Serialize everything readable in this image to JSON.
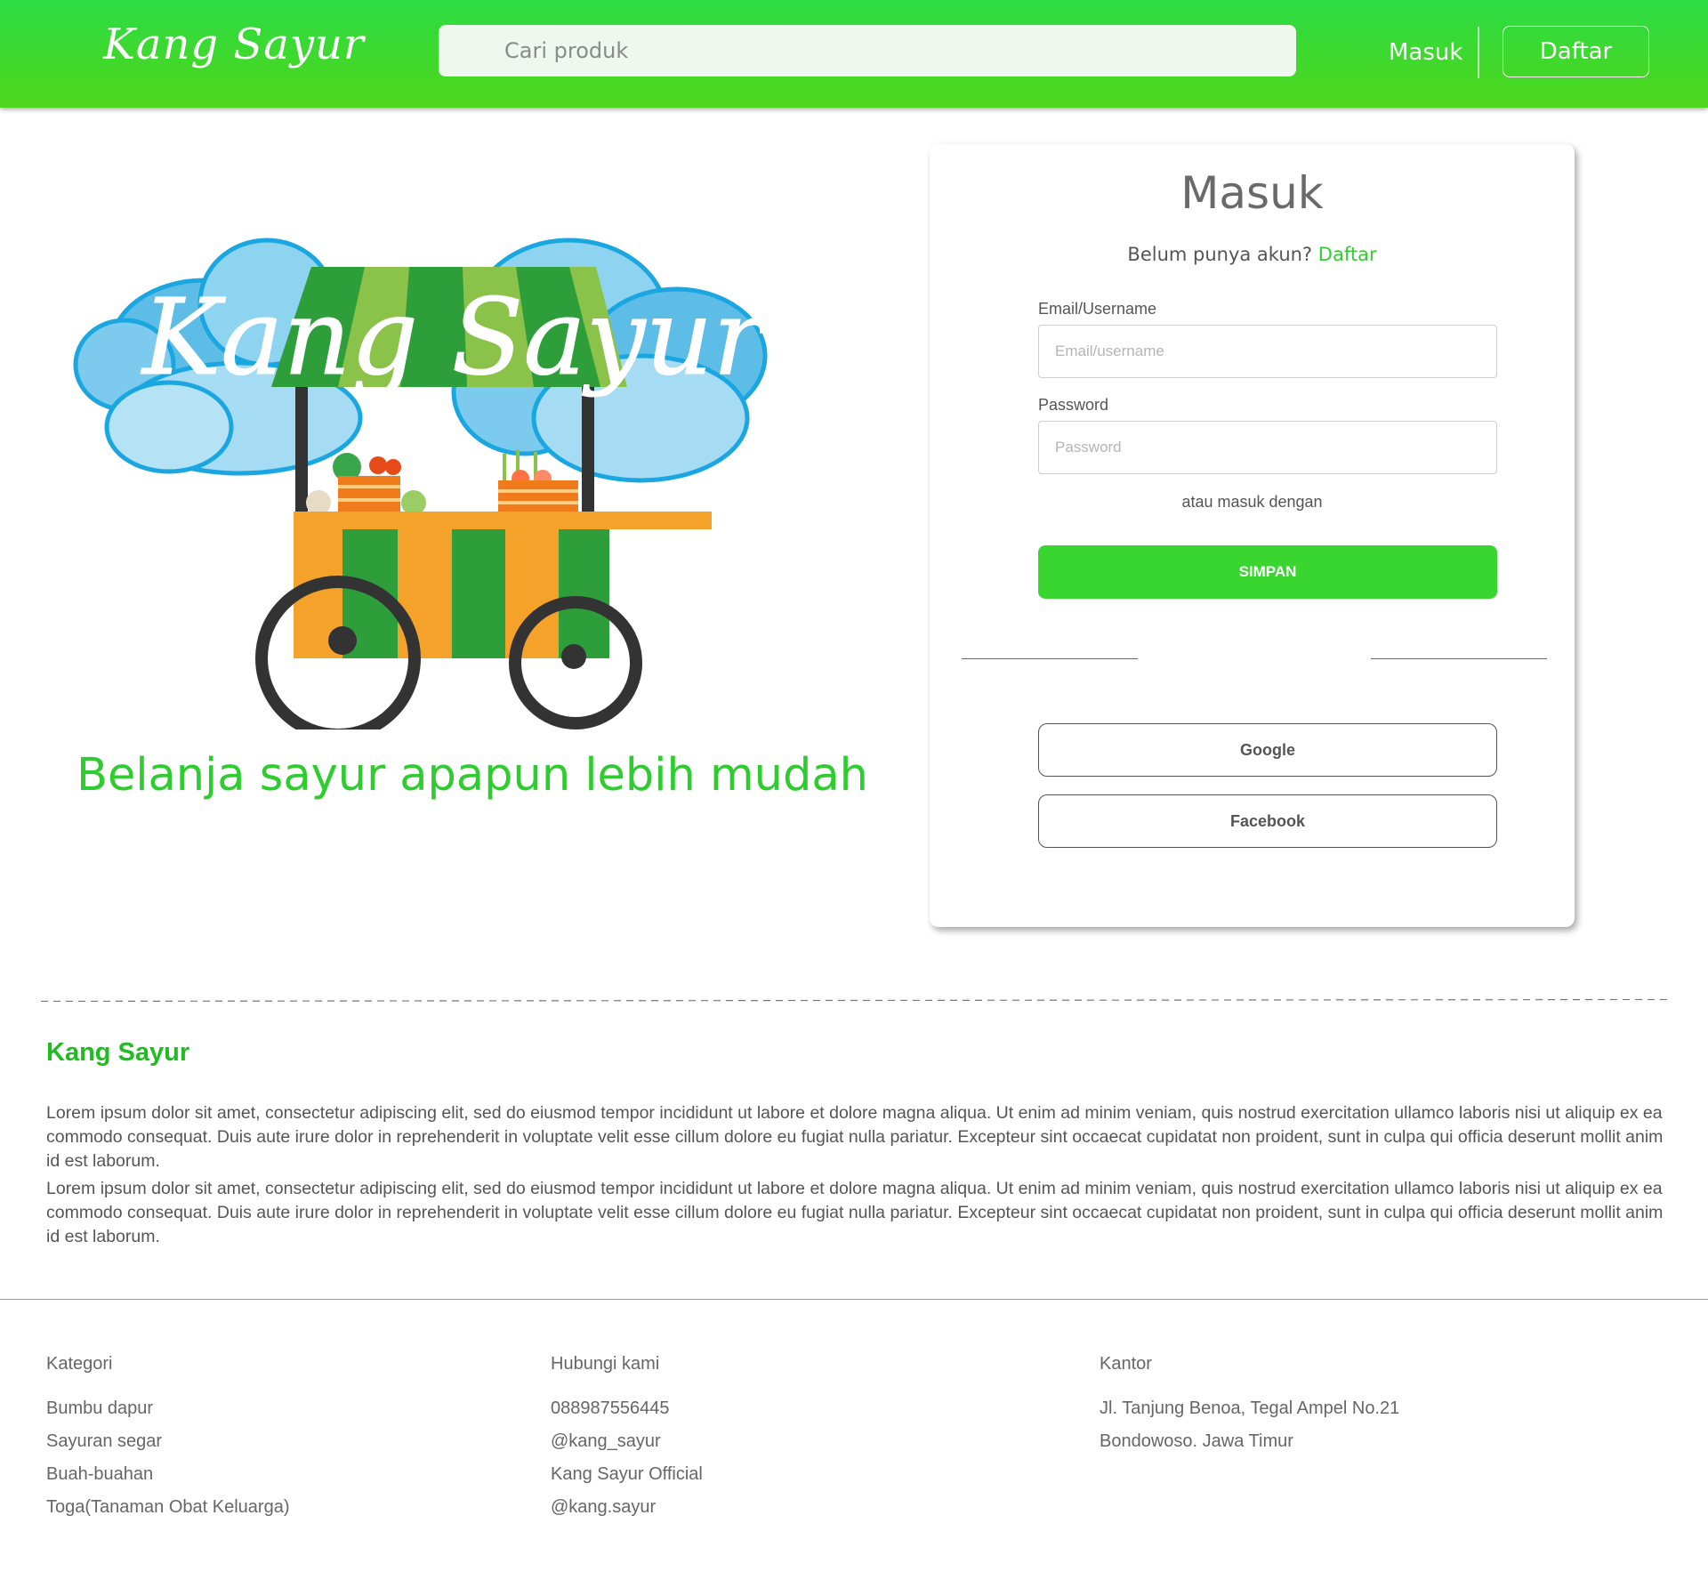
{
  "header": {
    "logo": "Kang Sayur",
    "search_placeholder": "Cari produk",
    "login_label": "Masuk",
    "register_label": "Daftar"
  },
  "hero": {
    "image_logo_text": "Kang Sayur",
    "tagline": "Belanja sayur apapun lebih mudah"
  },
  "login": {
    "title": "Masuk",
    "no_account_text": "Belum punya akun?",
    "register_link": "Daftar",
    "email_label": "Email/Username",
    "email_placeholder": "Email/username",
    "password_label": "Password",
    "password_placeholder": "Password",
    "alt_login_text": "atau masuk dengan",
    "submit_label": "SIMPAN",
    "google_label": "Google",
    "facebook_label": "Facebook"
  },
  "about": {
    "title": "Kang Sayur",
    "paragraphs": [
      "Lorem ipsum dolor sit amet, consectetur adipiscing elit, sed do eiusmod tempor incididunt ut labore et dolore magna aliqua. Ut enim ad minim veniam, quis nostrud exercitation ullamco laboris nisi ut aliquip ex ea commodo consequat. Duis aute irure dolor in reprehenderit in voluptate velit esse cillum dolore eu fugiat nulla pariatur. Excepteur sint occaecat cupidatat non proident, sunt in culpa qui officia deserunt mollit anim id est laborum.",
      "Lorem ipsum dolor sit amet, consectetur adipiscing elit, sed do eiusmod tempor incididunt ut labore et dolore magna aliqua. Ut enim ad minim veniam, quis nostrud exercitation ullamco laboris nisi ut aliquip ex ea commodo consequat. Duis aute irure dolor in reprehenderit in voluptate velit esse cillum dolore eu fugiat nulla pariatur. Excepteur sint occaecat cupidatat non proident, sunt in culpa qui officia deserunt mollit anim id est laborum."
    ]
  },
  "footer": {
    "kategori": {
      "title": "Kategori",
      "items": [
        "Bumbu dapur",
        "Sayuran segar",
        "Buah-buahan",
        "Toga(Tanaman Obat Keluarga)"
      ]
    },
    "hubungi": {
      "title": "Hubungi kami",
      "items": [
        "088987556445",
        "@kang_sayur",
        "Kang Sayur Official",
        "@kang.sayur"
      ]
    },
    "kantor": {
      "title": "Kantor",
      "items": [
        "Jl. Tanjung Benoa, Tegal Ampel No.21",
        "Bondowoso. Jawa Timur"
      ]
    }
  },
  "colors": {
    "brand_green": "#33cc33",
    "header_green": "#2cdc44",
    "button_green": "#38d62e",
    "cart_orange": "#f5a22b",
    "cart_green": "#35a540",
    "cloud_blue": "#7cc9ea"
  }
}
